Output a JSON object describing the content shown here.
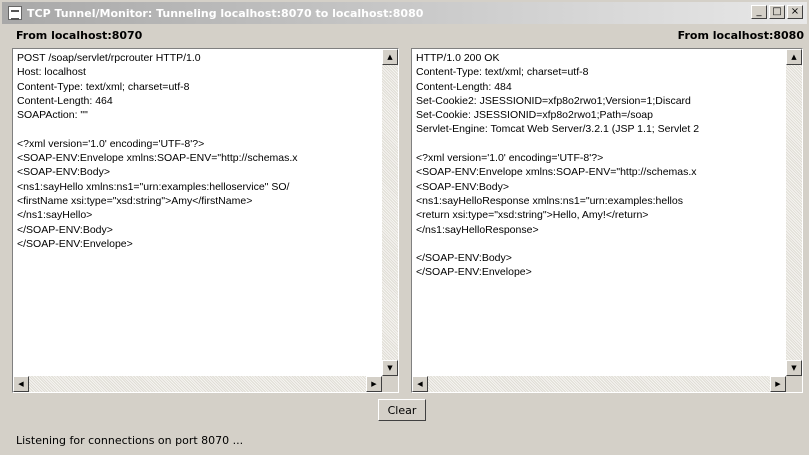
{
  "window": {
    "title": "TCP Tunnel/Monitor: Tunneling localhost:8070 to localhost:8080",
    "minimize_glyph": "_",
    "maximize_glyph": "□",
    "close_glyph": "×"
  },
  "left_header": "From localhost:8070",
  "right_header": "From localhost:8080",
  "left_pane": {
    "lines": [
      "POST /soap/servlet/rpcrouter HTTP/1.0",
      "Host: localhost",
      "Content-Type: text/xml; charset=utf-8",
      "Content-Length: 464",
      "SOAPAction: \"\"",
      "",
      "<?xml version='1.0' encoding='UTF-8'?>",
      "<SOAP-ENV:Envelope xmlns:SOAP-ENV=\"http://schemas.x",
      "<SOAP-ENV:Body>",
      "<ns1:sayHello xmlns:ns1=\"urn:examples:helloservice\" SO/",
      "<firstName xsi:type=\"xsd:string\">Amy</firstName>",
      "</ns1:sayHello>",
      "</SOAP-ENV:Body>",
      "</SOAP-ENV:Envelope>"
    ]
  },
  "right_pane": {
    "lines": [
      "HTTP/1.0 200 OK",
      "Content-Type: text/xml; charset=utf-8",
      "Content-Length: 484",
      "Set-Cookie2: JSESSIONID=xfp8o2rwo1;Version=1;Discard",
      "Set-Cookie: JSESSIONID=xfp8o2rwo1;Path=/soap",
      "Servlet-Engine: Tomcat Web Server/3.2.1 (JSP 1.1; Servlet 2",
      "",
      "<?xml version='1.0' encoding='UTF-8'?>",
      "<SOAP-ENV:Envelope xmlns:SOAP-ENV=\"http://schemas.x",
      "<SOAP-ENV:Body>",
      "<ns1:sayHelloResponse xmlns:ns1=\"urn:examples:hellos",
      "<return xsi:type=\"xsd:string\">Hello, Amy!</return>",
      "</ns1:sayHelloResponse>",
      "",
      "</SOAP-ENV:Body>",
      "</SOAP-ENV:Envelope>"
    ]
  },
  "clear_label": "Clear",
  "status_text": "Listening for connections on port 8070 ...",
  "icons": {
    "app": "tunnel-app-icon",
    "scroll_up": "▲",
    "scroll_down": "▼",
    "scroll_left": "◀",
    "scroll_right": "▶"
  }
}
